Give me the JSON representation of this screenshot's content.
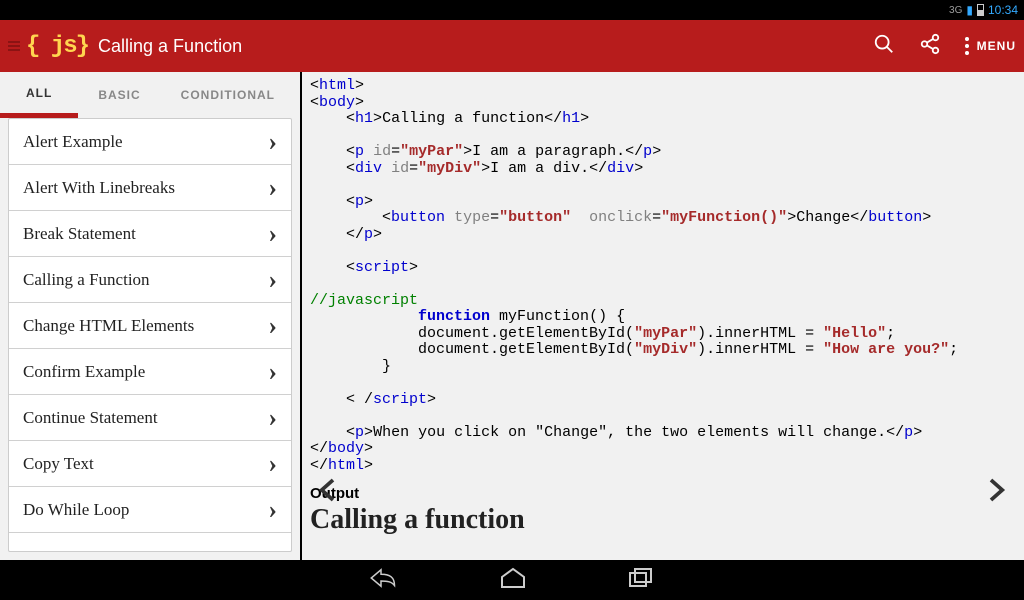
{
  "statusbar": {
    "net": "3G",
    "time": "10:34"
  },
  "actionbar": {
    "logo": "{ js}",
    "title": "Calling a Function",
    "menu_label": "MENU"
  },
  "tabs": [
    "ALL",
    "BASIC",
    "CONDITIONAL"
  ],
  "tab_active": 0,
  "list_items": [
    "Alert Example",
    "Alert With Linebreaks",
    "Break Statement",
    "Calling a Function",
    "Change HTML Elements",
    "Confirm Example",
    "Continue Statement",
    "Copy Text",
    "Do While Loop"
  ],
  "code": {
    "h1_txt": "Calling a function",
    "p_txt": "I am a paragraph.",
    "div_txt": "I am a div.",
    "btn_txt": "Change",
    "id1": "\"myPar\"",
    "id2": "\"myDiv\"",
    "btype": "\"button\"",
    "onclick": "\"myFunction()\"",
    "comment": "//javascript",
    "fn": "function",
    "fnname": " myFunction() {",
    "line1a": "            document.getElementById(",
    "line1b": ").innerHTML = ",
    "val1": "\"Hello\"",
    "val2": "\"How are you?\"",
    "brace": "        }",
    "last_p": "When you click on \"Change\", the two elements will change."
  },
  "output": {
    "label": "Output",
    "heading": "Calling a function"
  }
}
